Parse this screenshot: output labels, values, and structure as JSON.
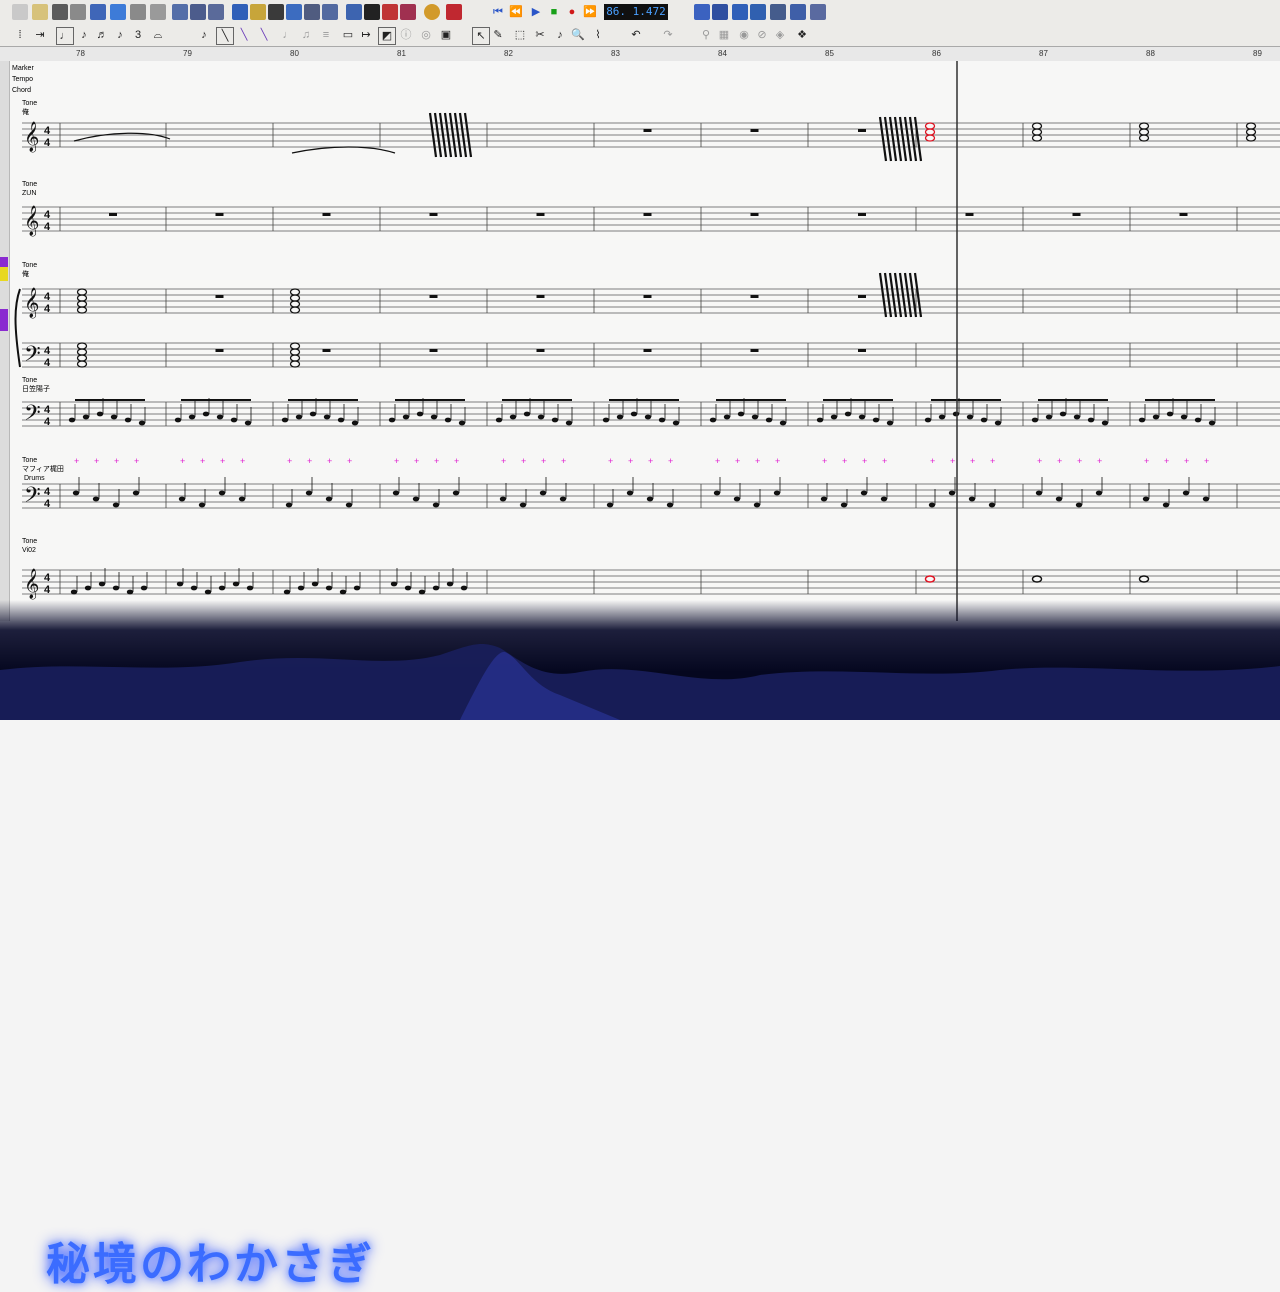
{
  "transport": {
    "counter": "86. 1.472"
  },
  "ruler": {
    "measures": [
      "78",
      "79",
      "80",
      "81",
      "82",
      "83",
      "84",
      "85",
      "86",
      "87",
      "88",
      "89"
    ]
  },
  "global_tracks": {
    "marker": "Marker",
    "tempo": "Tempo",
    "chord": "Chord"
  },
  "staves": [
    {
      "tone_label": "Tone",
      "instrument": "俺"
    },
    {
      "tone_label": "Tone",
      "instrument": "ZUN"
    },
    {
      "tone_label": "Tone",
      "instrument": "俺"
    },
    {
      "tone_label": "Tone",
      "instrument": "日笠陽子"
    },
    {
      "tone_label": "Tone",
      "instrument": "マフィア梶田",
      "sub": "Drums"
    },
    {
      "tone_label": "Tone",
      "instrument": "Vi02"
    }
  ],
  "overlay": {
    "title": "秘境のわかさぎ"
  },
  "colors": {
    "playhead": "#303030",
    "selected_note": "#e01020",
    "drum_accent": "#e020d0",
    "title": "#3b6cff"
  }
}
